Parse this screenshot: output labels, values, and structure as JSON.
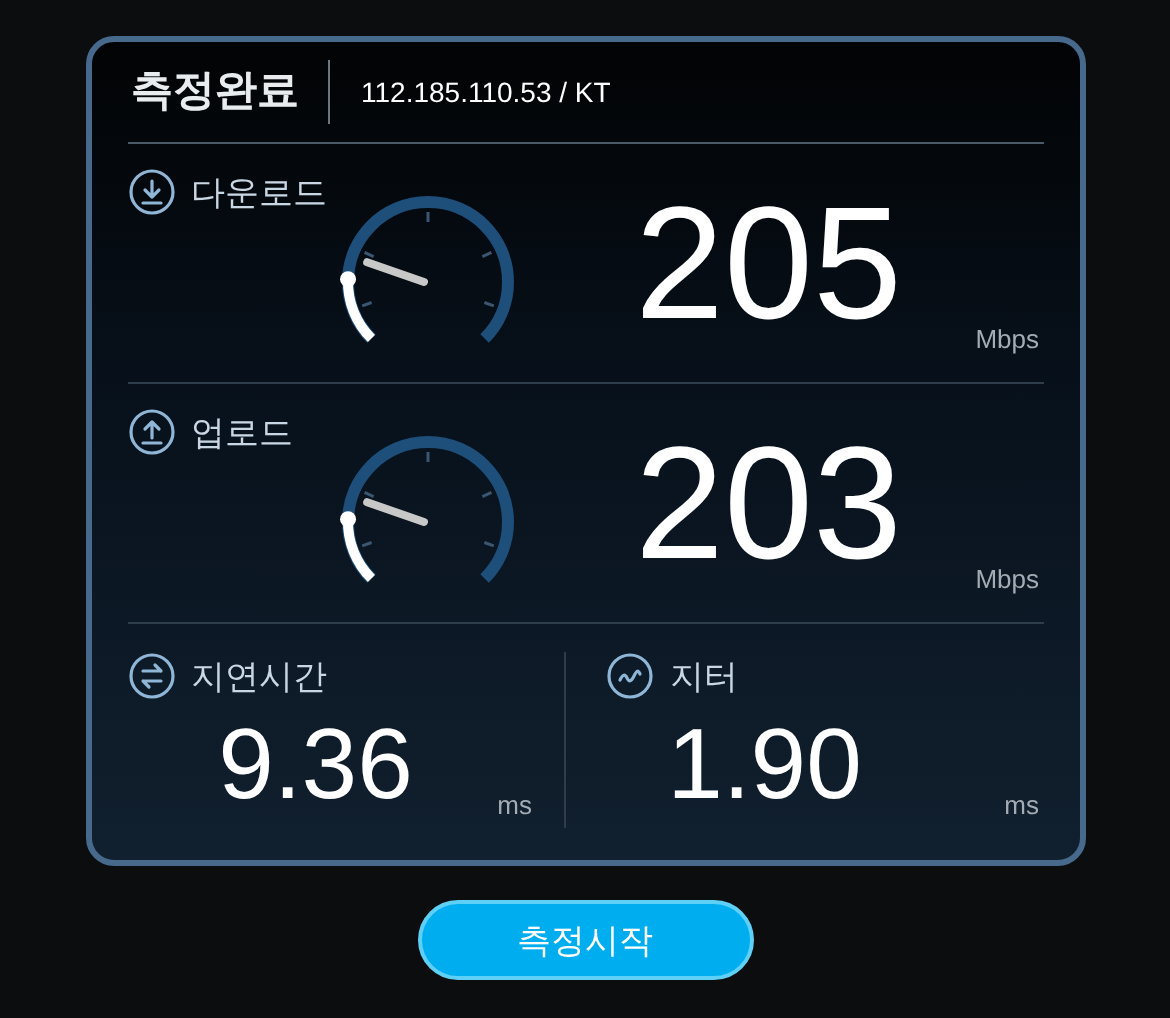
{
  "header": {
    "title": "측정완료",
    "server": "112.185.110.53 / KT"
  },
  "speeds": [
    {
      "kind": "download",
      "label": "다운로드",
      "value": "205",
      "unit": "Mbps"
    },
    {
      "kind": "upload",
      "label": "업로드",
      "value": "203",
      "unit": "Mbps"
    }
  ],
  "metrics": [
    {
      "kind": "latency",
      "label": "지연시간",
      "value": "9.36",
      "unit": "ms"
    },
    {
      "kind": "jitter",
      "label": "지터",
      "value": "1.90",
      "unit": "ms"
    }
  ],
  "start_button": "측정시작"
}
